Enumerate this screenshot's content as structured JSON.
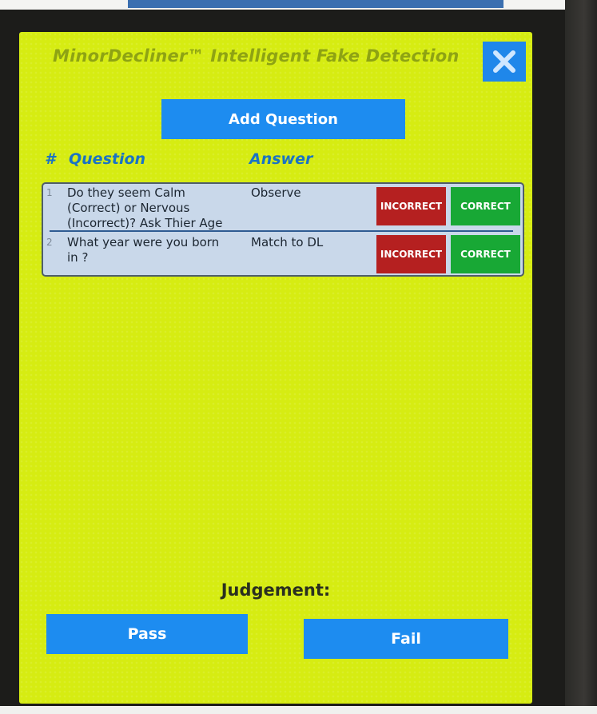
{
  "dialog": {
    "title": "MinorDecliner™ Intelligent Fake Detection",
    "close_icon": "close-icon",
    "add_question_label": "Add Question"
  },
  "table": {
    "headers": {
      "number": "#",
      "question": "Question",
      "answer": "Answer"
    },
    "rows": [
      {
        "number": "1",
        "question": "Do they seem Calm (Correct) or Nervous (Incorrect)? Ask Thier Age",
        "answer": "Observe",
        "incorrect_label": "INCORRECT",
        "correct_label": "CORRECT"
      },
      {
        "number": "2",
        "question": "What year were you born in ?",
        "answer": "Match to DL",
        "incorrect_label": "INCORRECT",
        "correct_label": "CORRECT"
      }
    ]
  },
  "judgement": {
    "label": "Judgement:",
    "pass_label": "Pass",
    "fail_label": "Fail"
  },
  "colors": {
    "background": "#d6ec12",
    "button_blue": "#1d8cf0",
    "incorrect_red": "#b52020",
    "correct_green": "#18a835",
    "header_blue": "#1a73c4"
  }
}
